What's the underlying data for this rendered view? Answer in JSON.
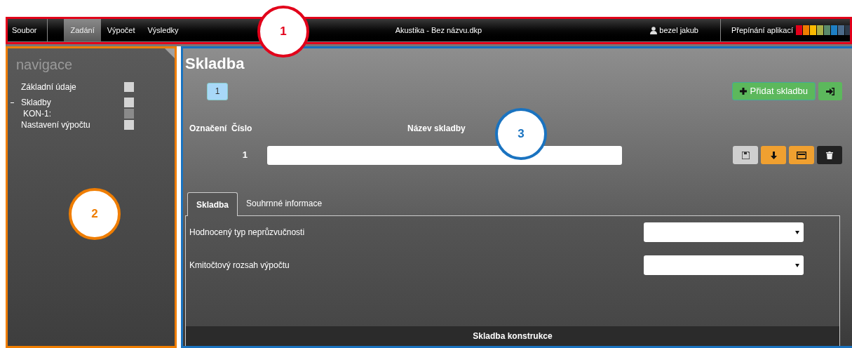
{
  "menu_bar": {
    "file_menu": "Soubor",
    "tabs": [
      {
        "label": "Zadání",
        "selected": true
      },
      {
        "label": "Výpočet",
        "selected": false
      },
      {
        "label": "Výsledky",
        "selected": false
      }
    ],
    "title": "Akustika - Bez názvu.dkp",
    "user": "bezel jakub",
    "app_switch_label": "Přepínání aplikací",
    "app_colors": [
      {
        "color": "#e2001a"
      },
      {
        "color": "#ef7d00"
      },
      {
        "color": "#fbba00"
      },
      {
        "color": "#a8b04a"
      },
      {
        "color": "#5a8a6a"
      },
      {
        "color": "#1e7fc4"
      },
      {
        "color": "#4b6a8a"
      },
      {
        "color": "#2c3a4a"
      }
    ]
  },
  "sidebar": {
    "title": "navigace",
    "items": [
      {
        "label": "Základní údaje",
        "color": "#d4d4d4"
      },
      {
        "label": "Skladby",
        "color": "#d4d4d4",
        "expanded": true,
        "children": [
          {
            "label": "KON-1:",
            "color": "#8a8a8a"
          }
        ]
      },
      {
        "label": "Nastavení výpočtu",
        "color": "#d4d4d4"
      }
    ]
  },
  "content": {
    "title": "Skladba",
    "pages": [
      {
        "label": "1",
        "selected": true
      }
    ],
    "add_button": "Přidat skladbu",
    "columns": [
      "Označení",
      "Číslo",
      "Název skladby"
    ],
    "rows": [
      {
        "number": "1"
      }
    ],
    "tabs": [
      {
        "label": "Skladba",
        "selected": true
      },
      {
        "label": "Souhrnné informace",
        "selected": false
      }
    ],
    "fields": [
      {
        "label": "Hodnocený typ neprůzvučnosti"
      },
      {
        "label": "Kmitočtový rozsah výpočtu"
      }
    ],
    "section_header": "Skladba konstrukce"
  },
  "annotations": [
    {
      "label": "1",
      "color": "#e2001a"
    },
    {
      "label": "2",
      "color": "#ef7d00"
    },
    {
      "label": "3",
      "color": "#1a73c0"
    }
  ]
}
